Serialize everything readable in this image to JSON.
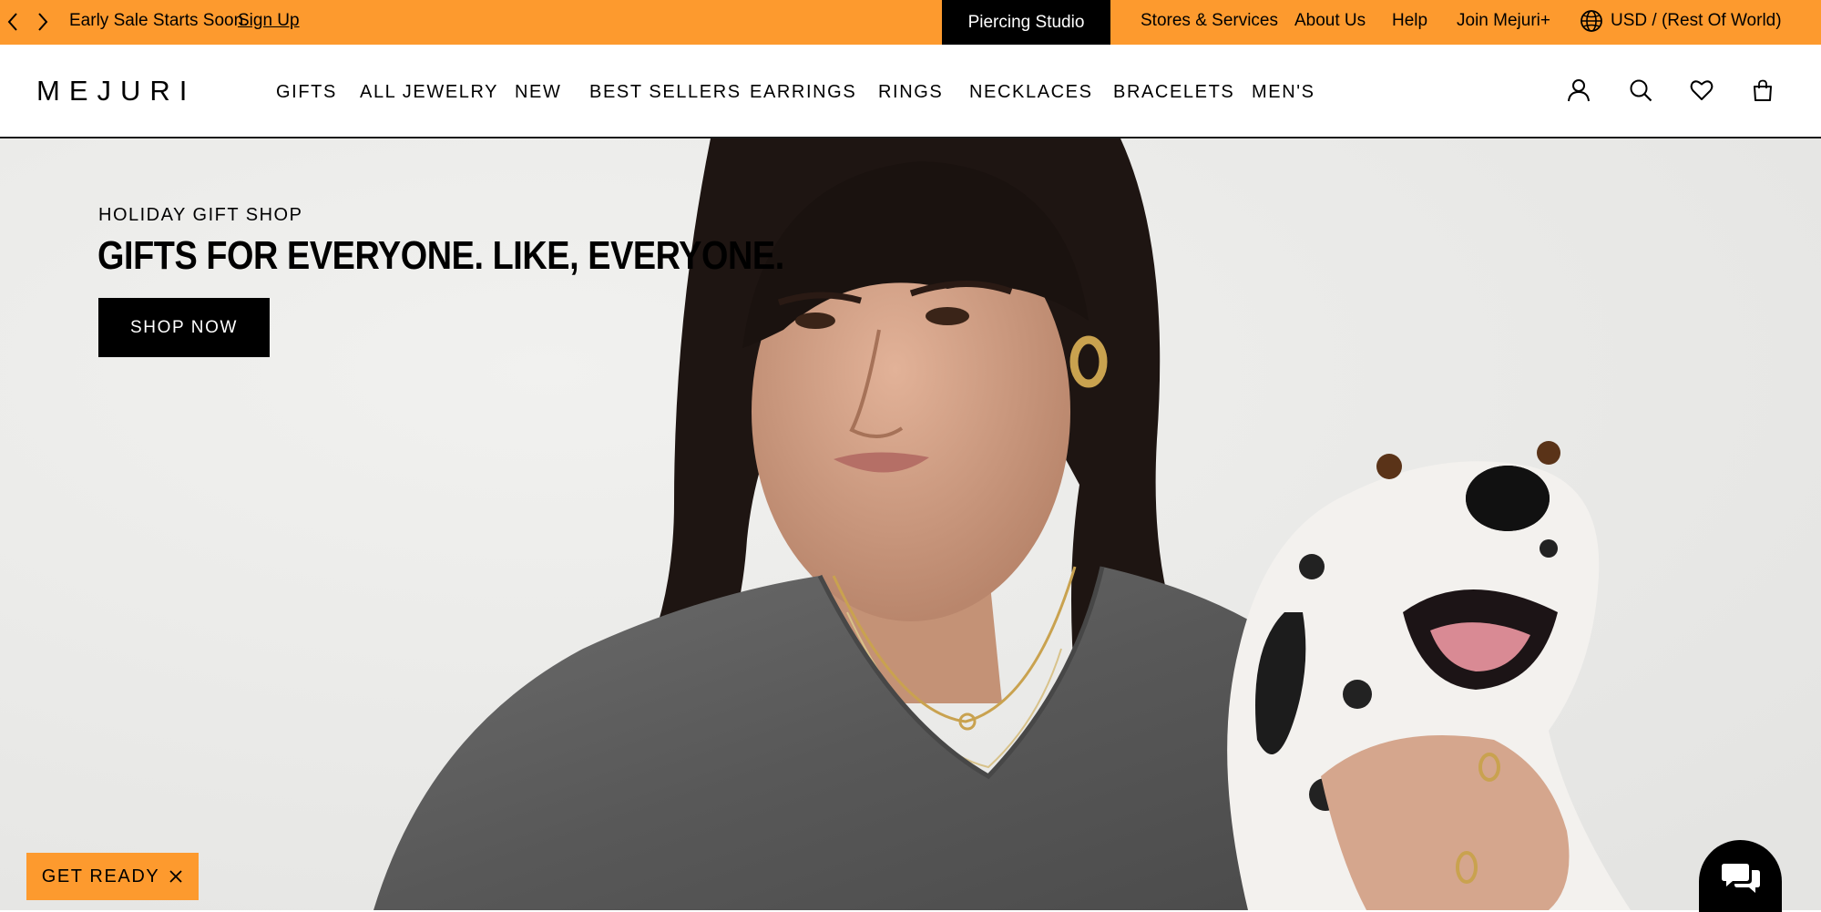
{
  "promo_bar": {
    "prev_icon": "chevron-left-icon",
    "next_icon": "chevron-right-icon",
    "message": "Early Sale Starts Soon.",
    "link_label": "Sign Up",
    "piercing_studio_label": "Piercing Studio",
    "links": [
      "Stores & Services",
      "About Us",
      "Help",
      "Join Mejuri+"
    ],
    "currency_icon": "globe-icon",
    "currency_label": "USD / (Rest Of World)",
    "colors": {
      "background": "#fd9a2e",
      "active_tab": "#000000"
    }
  },
  "header": {
    "logo": "MEJURI",
    "nav": [
      "GIFTS",
      "ALL JEWELRY",
      "NEW",
      "BEST SELLERS",
      "EARRINGS",
      "RINGS",
      "NECKLACES",
      "BRACELETS",
      "MEN'S"
    ],
    "icons": [
      "account-icon",
      "search-icon",
      "wishlist-heart-icon",
      "shopping-bag-icon"
    ]
  },
  "hero": {
    "eyebrow": "HOLIDAY GIFT SHOP",
    "title": "GIFTS FOR EVERYONE. LIKE, EVERYONE.",
    "cta_label": "SHOP NOW",
    "image": "hero-photo-woman-with-dalmatian"
  },
  "floating": {
    "get_ready_label": "GET READY",
    "get_ready_close_icon": "close-icon",
    "chat_icon": "chat-bubbles-icon",
    "accent_color": "#fd9a2e"
  }
}
